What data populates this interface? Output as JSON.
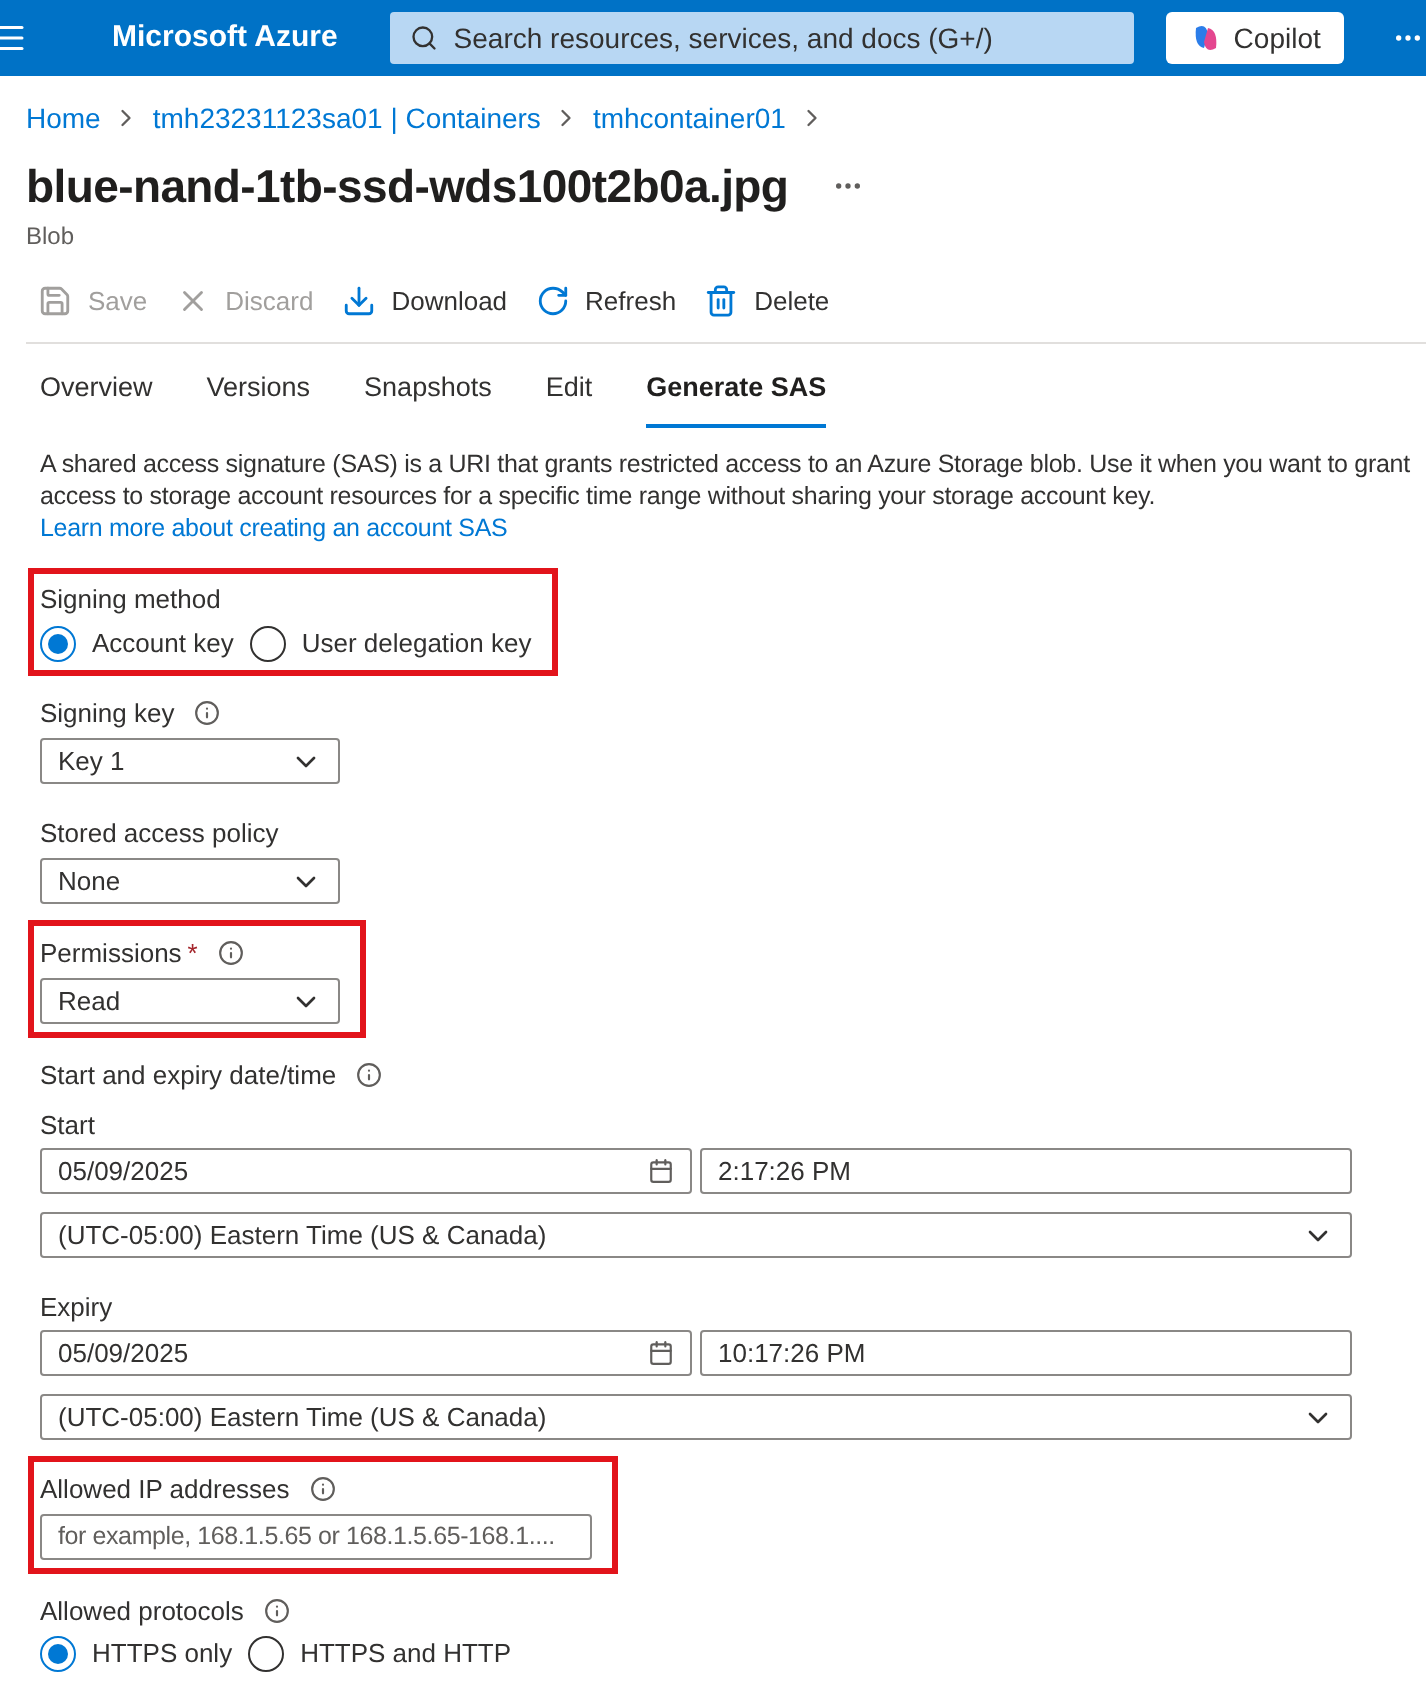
{
  "header": {
    "brand": "Microsoft Azure",
    "search_placeholder": "Search resources, services, and docs (G+/)",
    "copilot": "Copilot"
  },
  "breadcrumb": [
    "Home",
    "tmh23231123sa01 | Containers",
    "tmhcontainer01"
  ],
  "title": "blue-nand-1tb-ssd-wds100t2b0a.jpg",
  "subtitle": "Blob",
  "toolbar": [
    {
      "kind": "save",
      "label": "Save",
      "disabled": true
    },
    {
      "kind": "discard",
      "label": "Discard",
      "disabled": true
    },
    {
      "kind": "download",
      "label": "Download",
      "disabled": false
    },
    {
      "kind": "refresh",
      "label": "Refresh",
      "disabled": false
    },
    {
      "kind": "delete",
      "label": "Delete",
      "disabled": false
    }
  ],
  "tabs": [
    {
      "label": "Overview",
      "selected": false
    },
    {
      "label": "Versions",
      "selected": false
    },
    {
      "label": "Snapshots",
      "selected": false
    },
    {
      "label": "Edit",
      "selected": false
    },
    {
      "label": "Generate SAS",
      "selected": true
    }
  ],
  "description": {
    "text": "A shared access signature (SAS) is a URI that grants restricted access to an Azure Storage blob. Use it when you want to grant access to storage account resources for a specific time range without sharing your storage account key.",
    "link": "Learn more about creating an account SAS"
  },
  "fields": [
    {
      "kind": "radio",
      "label": "Signing method",
      "info": false,
      "highlighted": true,
      "options": [
        {
          "label": "Account key",
          "selected": true
        },
        {
          "label": "User delegation key",
          "selected": false
        }
      ]
    },
    {
      "kind": "select",
      "label": "Signing key",
      "info": true,
      "highlighted": false,
      "value": "Key 1"
    },
    {
      "kind": "select",
      "label": "Stored access policy",
      "info": false,
      "highlighted": false,
      "value": "None"
    },
    {
      "kind": "select",
      "label": "Permissions",
      "required_mark": "*",
      "info": true,
      "highlighted": true,
      "value": "Read"
    },
    {
      "kind": "heading",
      "label": "Start and expiry date/time",
      "info": true,
      "highlighted": false
    },
    {
      "kind": "datetime",
      "label": "Start",
      "info": false,
      "highlighted": false,
      "date": "05/09/2025",
      "time": "2:17:26 PM",
      "timezone": "(UTC-05:00) Eastern Time (US & Canada)"
    },
    {
      "kind": "datetime",
      "label": "Expiry",
      "info": false,
      "highlighted": false,
      "date": "05/09/2025",
      "time": "10:17:26 PM",
      "timezone": "(UTC-05:00) Eastern Time (US & Canada)"
    },
    {
      "kind": "text",
      "label": "Allowed IP addresses",
      "info": true,
      "highlighted": true,
      "placeholder": "for example, 168.1.5.65 or 168.1.5.65-168.1...."
    },
    {
      "kind": "radio",
      "label": "Allowed protocols",
      "info": true,
      "highlighted": false,
      "options": [
        {
          "label": "HTTPS only",
          "selected": true
        },
        {
          "label": "HTTPS and HTTP",
          "selected": false
        }
      ]
    }
  ]
}
